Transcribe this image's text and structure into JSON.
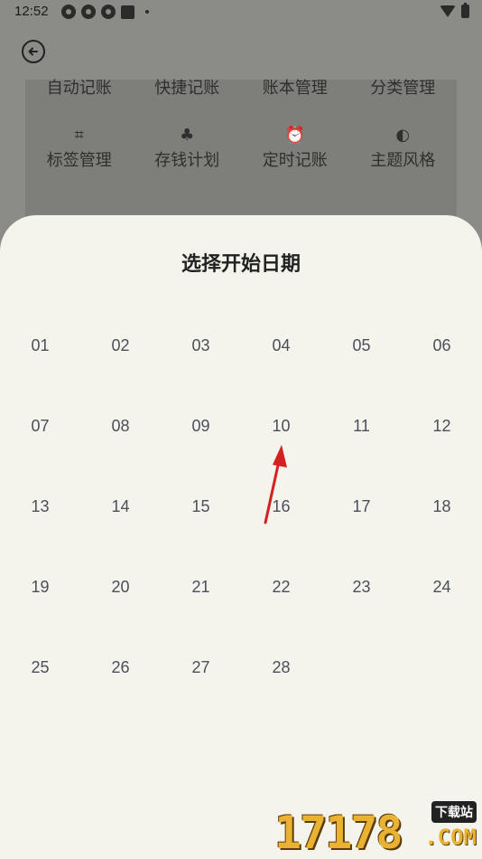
{
  "status_bar": {
    "time": "12:52",
    "notification_icons": [
      "sync-icon",
      "sync-icon",
      "sync-icon",
      "square-icon",
      "dot-icon"
    ],
    "right_icons": [
      "wifi-icon",
      "battery-icon"
    ]
  },
  "header": {
    "back_icon": "back-arrow-circle-icon"
  },
  "menu_grid": {
    "row1": [
      {
        "label": "自动记账"
      },
      {
        "label": "快捷记账"
      },
      {
        "label": "账本管理"
      },
      {
        "label": "分类管理"
      }
    ],
    "row2": [
      {
        "label": "标签管理",
        "icon": "tag-icon",
        "glyph": "⌗"
      },
      {
        "label": "存钱计划",
        "icon": "sprout-icon",
        "glyph": "♣"
      },
      {
        "label": "定时记账",
        "icon": "alarm-icon",
        "glyph": "⏰"
      },
      {
        "label": "主题风格",
        "icon": "palette-icon",
        "glyph": "◐"
      }
    ]
  },
  "sheet": {
    "title": "选择开始日期",
    "days": [
      "01",
      "02",
      "03",
      "04",
      "05",
      "06",
      "07",
      "08",
      "09",
      "10",
      "11",
      "12",
      "13",
      "14",
      "15",
      "16",
      "17",
      "18",
      "19",
      "20",
      "21",
      "22",
      "23",
      "24",
      "25",
      "26",
      "27",
      "28"
    ]
  },
  "watermark": {
    "main": "17178",
    "tag": "下载站",
    "com": ".COM"
  },
  "colors": {
    "sheet_bg": "#f4f4ec",
    "scrim": "#8b8b87",
    "day_text": "#4a4f59",
    "arrow": "#d42020",
    "watermark": "#e9b233"
  }
}
